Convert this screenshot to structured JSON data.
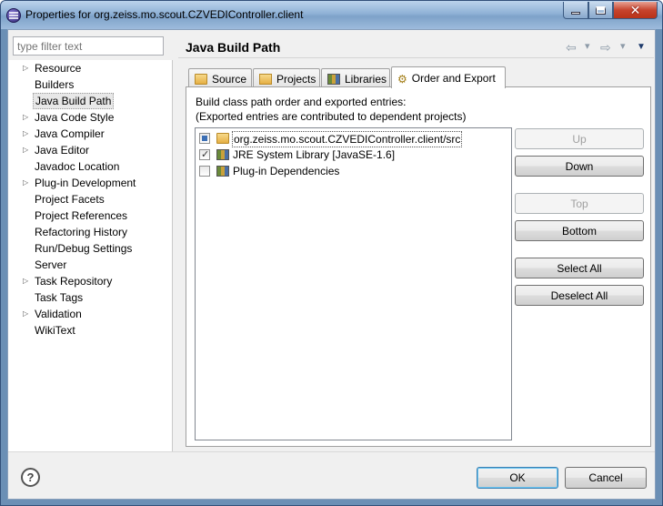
{
  "window": {
    "title": "Properties for org.zeiss.mo.scout.CZVEDIController.client",
    "min_glyph": "",
    "max_glyph": "",
    "close_glyph": "✕"
  },
  "filter": {
    "placeholder": "type filter text"
  },
  "tree": {
    "items": [
      {
        "label": "Resource",
        "expandable": true
      },
      {
        "label": "Builders",
        "expandable": false
      },
      {
        "label": "Java Build Path",
        "expandable": false,
        "selected": true
      },
      {
        "label": "Java Code Style",
        "expandable": true
      },
      {
        "label": "Java Compiler",
        "expandable": true
      },
      {
        "label": "Java Editor",
        "expandable": true
      },
      {
        "label": "Javadoc Location",
        "expandable": false
      },
      {
        "label": "Plug-in Development",
        "expandable": true
      },
      {
        "label": "Project Facets",
        "expandable": false
      },
      {
        "label": "Project References",
        "expandable": false
      },
      {
        "label": "Refactoring History",
        "expandable": false
      },
      {
        "label": "Run/Debug Settings",
        "expandable": false
      },
      {
        "label": "Server",
        "expandable": false
      },
      {
        "label": "Task Repository",
        "expandable": true
      },
      {
        "label": "Task Tags",
        "expandable": false
      },
      {
        "label": "Validation",
        "expandable": true
      },
      {
        "label": "WikiText",
        "expandable": false
      }
    ]
  },
  "page": {
    "title": "Java Build Path",
    "nav_back": "⇦",
    "nav_back_menu": "▾",
    "nav_forward": "⇨",
    "nav_forward_menu": "▾",
    "view_menu": "▼"
  },
  "tabs": [
    {
      "label": "Source",
      "icon": "source-folder-icon"
    },
    {
      "label": "Projects",
      "icon": "project-icon"
    },
    {
      "label": "Libraries",
      "icon": "library-icon"
    },
    {
      "label": "Order and Export",
      "icon": "order-export-icon",
      "active": true
    }
  ],
  "order": {
    "description_line1": "Build class path order and exported entries:",
    "description_line2": "(Exported entries are contributed to dependent projects)",
    "entries": [
      {
        "label": "org.zeiss.mo.scout.CZVEDIController.client/src",
        "state": "partial",
        "icon": "source-folder-icon"
      },
      {
        "label": "JRE System Library [JavaSE-1.6]",
        "state": "checked",
        "icon": "library-icon"
      },
      {
        "label": "Plug-in Dependencies",
        "state": "unchecked",
        "icon": "library-icon"
      }
    ],
    "buttons": {
      "up": "Up",
      "down": "Down",
      "top": "Top",
      "bottom": "Bottom",
      "select_all": "Select All",
      "deselect_all": "Deselect All"
    }
  },
  "dialog": {
    "help_glyph": "?",
    "ok": "OK",
    "cancel": "Cancel"
  }
}
